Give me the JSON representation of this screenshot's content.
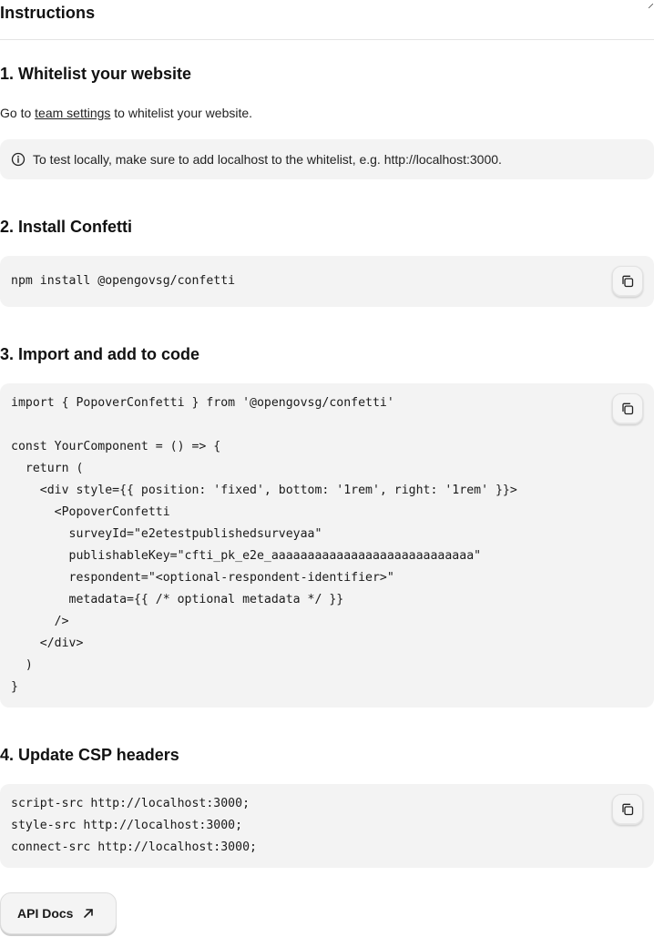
{
  "header": {
    "title": "Instructions"
  },
  "steps": {
    "s1": {
      "title": "1. Whitelist your website",
      "text_before": "Go to ",
      "link_label": "team settings",
      "text_after": " to whitelist your website.",
      "callout": "To test locally, make sure to add localhost to the whitelist, e.g. http://localhost:3000."
    },
    "s2": {
      "title": "2. Install Confetti",
      "code": "npm install @opengovsg/confetti"
    },
    "s3": {
      "title": "3. Import and add to code",
      "code": "import { PopoverConfetti } from '@opengovsg/confetti'\n\nconst YourComponent = () => {\n  return (\n    <div style={{ position: 'fixed', bottom: '1rem', right: '1rem' }}>\n      <PopoverConfetti\n        surveyId=\"e2etestpublishedsurveyaa\"\n        publishableKey=\"cfti_pk_e2e_aaaaaaaaaaaaaaaaaaaaaaaaaaaa\"\n        respondent=\"<optional-respondent-identifier>\"\n        metadata={{ /* optional metadata */ }}\n      />\n    </div>\n  )\n}"
    },
    "s4": {
      "title": "4. Update CSP headers",
      "code": "script-src http://localhost:3000;\nstyle-src http://localhost:3000;\nconnect-src http://localhost:3000;"
    }
  },
  "api_docs": {
    "label": "API Docs"
  },
  "icons": {
    "info": "info-icon",
    "copy": "copy-icon",
    "external": "arrow-up-right-icon"
  }
}
